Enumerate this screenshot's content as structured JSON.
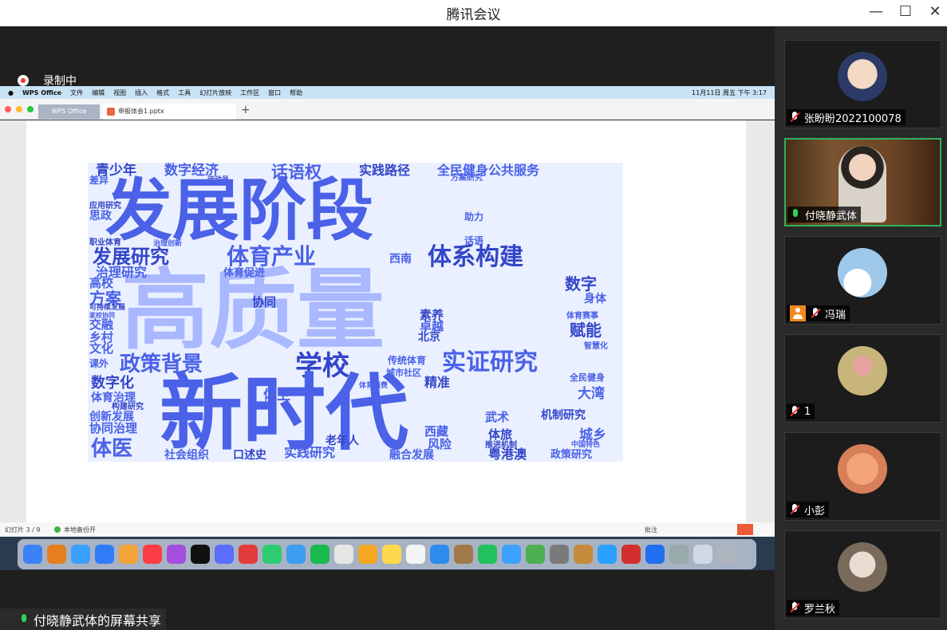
{
  "window": {
    "title": "腾讯会议"
  },
  "recording": {
    "label": "录制中"
  },
  "share_banner": {
    "label": "付晓静武体的屏幕共享"
  },
  "mac_menubar": {
    "items": [
      "WPS Office",
      "文件",
      "编辑",
      "视图",
      "插入",
      "格式",
      "工具",
      "幻灯片放映",
      "工作区",
      "窗口",
      "帮助"
    ],
    "clock": "11月11日 周五 下午 3:17"
  },
  "wps": {
    "tabs": {
      "office": "WPS Office",
      "doc": "申报体会1.pptx"
    },
    "status": {
      "slide": "幻灯片 3 / 9",
      "backup": "本地备份开",
      "annotate": "批注"
    }
  },
  "wordcloud": {
    "words": [
      "青少年",
      "数字经济",
      "话语权",
      "实践路径",
      "全民健身公共服务",
      "差异",
      "运动员",
      "方案研究",
      "发展阶段",
      "应用研究",
      "思政",
      "助力",
      "职业体育",
      "治理创新",
      "话语",
      "发展研究",
      "体育产业",
      "西南",
      "体系构建",
      "治理研究",
      "体育促进",
      "数字",
      "高校",
      "方案",
      "协同",
      "身体",
      "高质量",
      "可持续发展",
      "家校协同",
      "交融",
      "素养",
      "卓越",
      "体育赛事",
      "赋能",
      "乡村",
      "文化",
      "北京",
      "智慧化",
      "政策背景",
      "学校",
      "实证研究",
      "课外",
      "数字化",
      "传统体育",
      "城市社区",
      "精准",
      "全民健身",
      "体育治理",
      "新时代",
      "体卫",
      "大湾",
      "构建研究",
      "创新发展",
      "武术",
      "机制研究",
      "协同治理",
      "西藏",
      "体旅",
      "城乡",
      "体医",
      "老年人",
      "风险",
      "社会组织",
      "口述史",
      "实践研究",
      "融合发展",
      "粤港澳",
      "政策研究",
      "中国特色",
      "推进机制",
      "体育消费"
    ]
  },
  "participants": [
    {
      "name": "张盼盼2022100078",
      "mic": "muted"
    },
    {
      "name": "付晓静武体",
      "mic": "on"
    },
    {
      "name": "冯瑞",
      "mic": "muted"
    },
    {
      "name": "1",
      "mic": "muted"
    },
    {
      "name": "小彭",
      "mic": "muted"
    },
    {
      "name": "罗兰秋",
      "mic": "muted"
    }
  ],
  "colors": {
    "accent_green": "#2fb35a",
    "cloud_blue": "#4a61e8",
    "cloud_light": "#a9b8ff"
  }
}
